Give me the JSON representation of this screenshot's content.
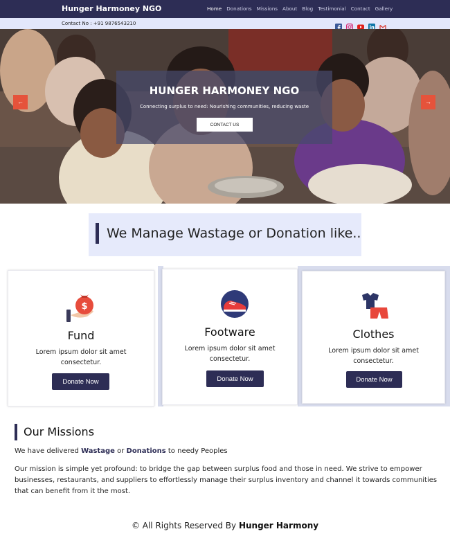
{
  "nav": {
    "brand": "Hunger Harmoney NGO",
    "links": [
      "Home",
      "Donations",
      "Missions",
      "About",
      "Blog",
      "Testimonial",
      "Contact",
      "Gallery"
    ]
  },
  "contact": {
    "text": "Contact No : +91 9876543210",
    "social_icons": [
      "facebook-icon",
      "instagram-icon",
      "youtube-icon",
      "linkedin-icon",
      "gmail-icon"
    ]
  },
  "hero": {
    "title": "HUNGER HARMONEY NGO",
    "subtitle": "Connecting surplus to need: Nourishing communities, reducing waste",
    "button": "CONTACT US",
    "prev_arrow": "←",
    "next_arrow": "→"
  },
  "manage": {
    "title": "We Manage Wastage or Donation like.."
  },
  "cards": [
    {
      "title": "Fund",
      "text_line1": "Lorem ipsum dolor sit amet",
      "text_line2": "consectetur.",
      "button": "Donate Now",
      "icon": "money-bag-icon"
    },
    {
      "title": "Footware",
      "text_line1": "Lorem ipsum dolor sit amet",
      "text_line2": "consectetur.",
      "button": "Donate Now",
      "icon": "shoe-icon"
    },
    {
      "title": "Clothes",
      "text_line1": "Lorem ipsum dolor sit amet",
      "text_line2": "consectetur.",
      "button": "Donate Now",
      "icon": "clothes-icon"
    }
  ],
  "missions": {
    "title": "Our Missions",
    "delivered_prefix": "We have delivered",
    "delivered_word1": "Wastage",
    "delivered_or": "or",
    "delivered_word2": "Donations",
    "delivered_suffix": "to needy Peoples",
    "text": "Our mission is simple yet profound: to bridge the gap between surplus food and those in need. We strive to empower businesses, restaurants, and suppliers to effortlessly manage their surplus inventory and channel it towards communities that can benefit from it the most."
  },
  "footer": {
    "prefix": "© All Rights Reserved By",
    "name": "Hunger Harmony"
  },
  "colors": {
    "navy": "#2d2d55",
    "accent_red": "#e5533b",
    "light_blue": "#e3e7fb"
  }
}
